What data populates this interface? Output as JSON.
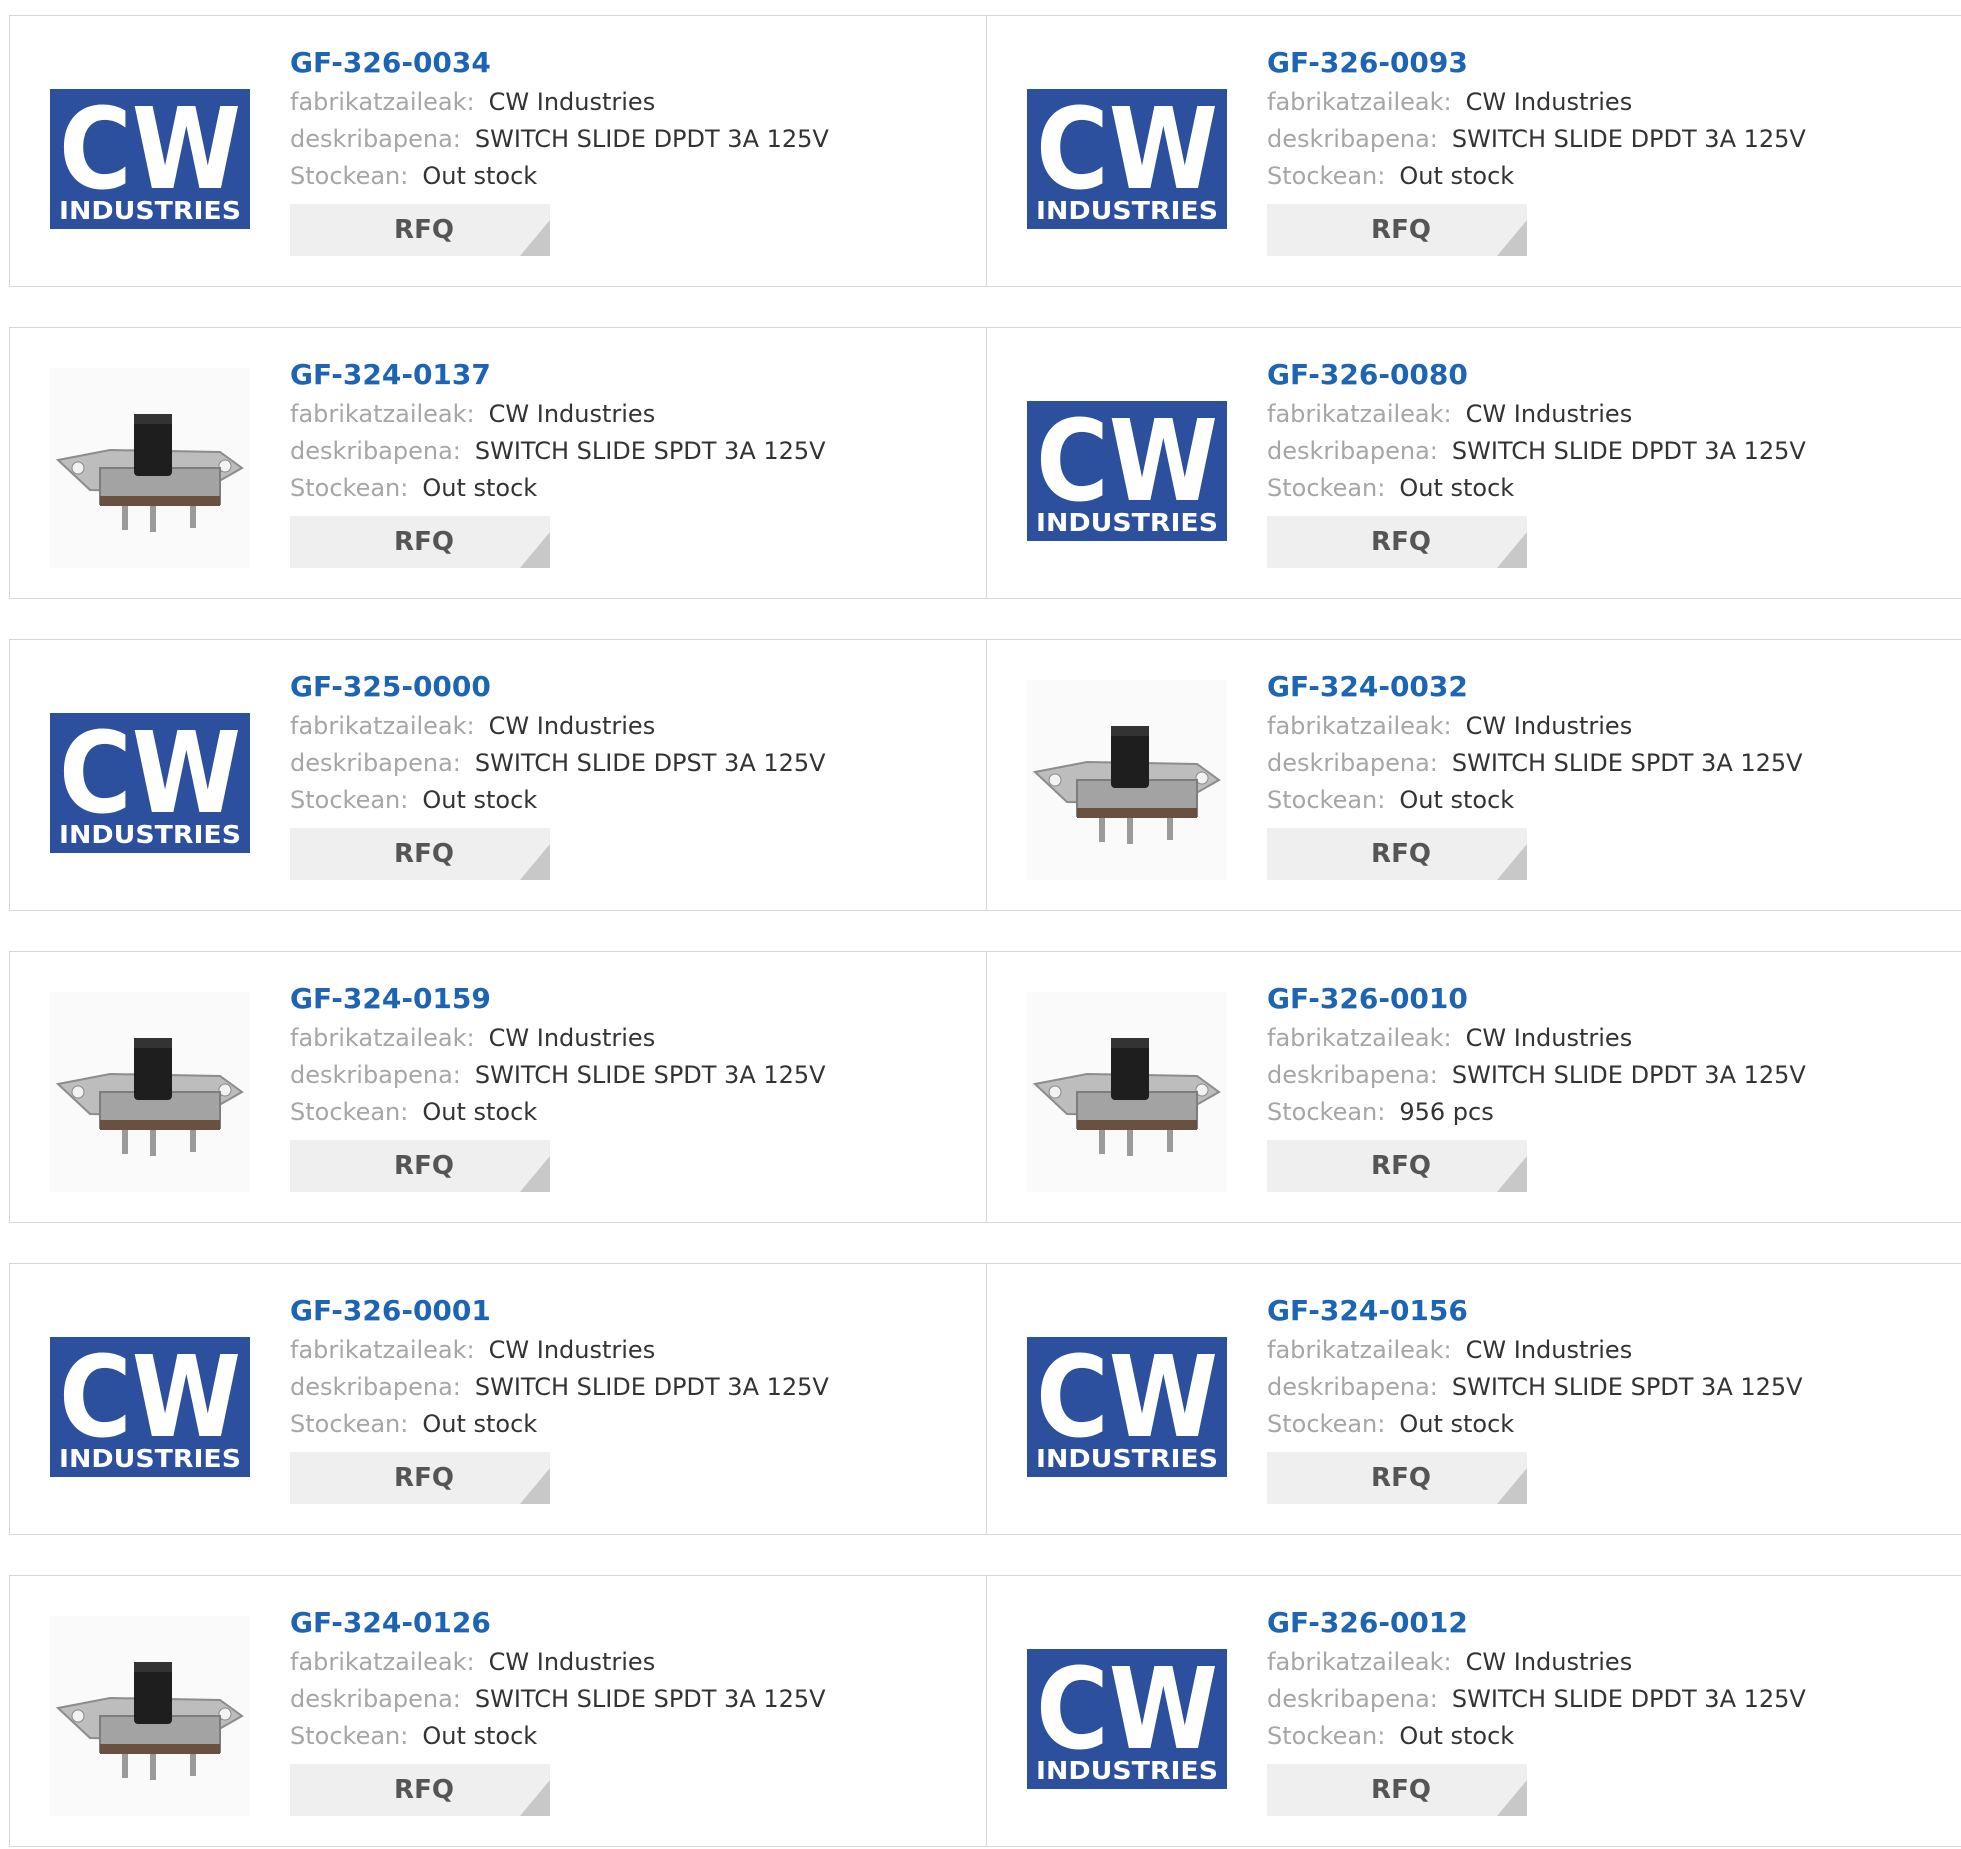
{
  "labels": {
    "manufacturer": "fabrikatzaileak:",
    "description": "deskribapena:",
    "stock": "Stockean:",
    "rfq": "RFQ"
  },
  "logo_text": {
    "big": "CW",
    "small": "INDUSTRIES"
  },
  "colors": {
    "accent": "#1e64b4",
    "logo_blue": "#2c4f9e"
  },
  "products": [
    {
      "part_no": "GF-326-0034",
      "manufacturer": "CW Industries",
      "description": "SWITCH SLIDE DPDT 3A 125V",
      "stock": "Out stock",
      "image": "logo"
    },
    {
      "part_no": "GF-326-0093",
      "manufacturer": "CW Industries",
      "description": "SWITCH SLIDE DPDT 3A 125V",
      "stock": "Out stock",
      "image": "logo"
    },
    {
      "part_no": "GF-324-0137",
      "manufacturer": "CW Industries",
      "description": "SWITCH SLIDE SPDT 3A 125V",
      "stock": "Out stock",
      "image": "switch"
    },
    {
      "part_no": "GF-326-0080",
      "manufacturer": "CW Industries",
      "description": "SWITCH SLIDE DPDT 3A 125V",
      "stock": "Out stock",
      "image": "logo"
    },
    {
      "part_no": "GF-325-0000",
      "manufacturer": "CW Industries",
      "description": "SWITCH SLIDE DPST 3A 125V",
      "stock": "Out stock",
      "image": "logo"
    },
    {
      "part_no": "GF-324-0032",
      "manufacturer": "CW Industries",
      "description": "SWITCH SLIDE SPDT 3A 125V",
      "stock": "Out stock",
      "image": "switch"
    },
    {
      "part_no": "GF-324-0159",
      "manufacturer": "CW Industries",
      "description": "SWITCH SLIDE SPDT 3A 125V",
      "stock": "Out stock",
      "image": "switch"
    },
    {
      "part_no": "GF-326-0010",
      "manufacturer": "CW Industries",
      "description": "SWITCH SLIDE DPDT 3A 125V",
      "stock": "956 pcs",
      "image": "switch"
    },
    {
      "part_no": "GF-326-0001",
      "manufacturer": "CW Industries",
      "description": "SWITCH SLIDE DPDT 3A 125V",
      "stock": "Out stock",
      "image": "logo"
    },
    {
      "part_no": "GF-324-0156",
      "manufacturer": "CW Industries",
      "description": "SWITCH SLIDE SPDT 3A 125V",
      "stock": "Out stock",
      "image": "logo"
    },
    {
      "part_no": "GF-324-0126",
      "manufacturer": "CW Industries",
      "description": "SWITCH SLIDE SPDT 3A 125V",
      "stock": "Out stock",
      "image": "switch"
    },
    {
      "part_no": "GF-326-0012",
      "manufacturer": "CW Industries",
      "description": "SWITCH SLIDE DPDT 3A 125V",
      "stock": "Out stock",
      "image": "logo"
    }
  ]
}
